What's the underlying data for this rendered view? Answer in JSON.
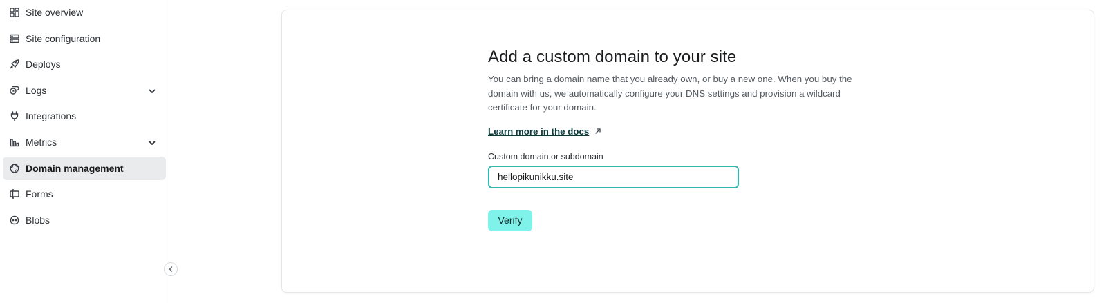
{
  "sidebar": {
    "items": [
      {
        "label": "Site overview",
        "icon": "grid-icon"
      },
      {
        "label": "Site configuration",
        "icon": "server-icon"
      },
      {
        "label": "Deploys",
        "icon": "rocket-icon"
      },
      {
        "label": "Logs",
        "icon": "logs-icon",
        "expandable": true
      },
      {
        "label": "Integrations",
        "icon": "plug-icon"
      },
      {
        "label": "Metrics",
        "icon": "bar-chart-icon",
        "expandable": true
      },
      {
        "label": "Domain management",
        "icon": "globe-icon",
        "active": true
      },
      {
        "label": "Forms",
        "icon": "forms-icon"
      },
      {
        "label": "Blobs",
        "icon": "blob-icon"
      }
    ]
  },
  "main": {
    "title": "Add a custom domain to your site",
    "description": "You can bring a domain name that you already own, or buy a new one. When you buy the domain with us, we automatically configure your DNS settings and provision a wildcard certificate for your domain.",
    "learn_more": "Learn more in the docs",
    "field_label": "Custom domain or subdomain",
    "domain_value": "hellopikunikku.site",
    "verify_label": "Verify"
  },
  "colors": {
    "accent_border": "#32b6ae",
    "verify_bg": "#7ff3ea",
    "active_nav_bg": "#e9ebed"
  }
}
